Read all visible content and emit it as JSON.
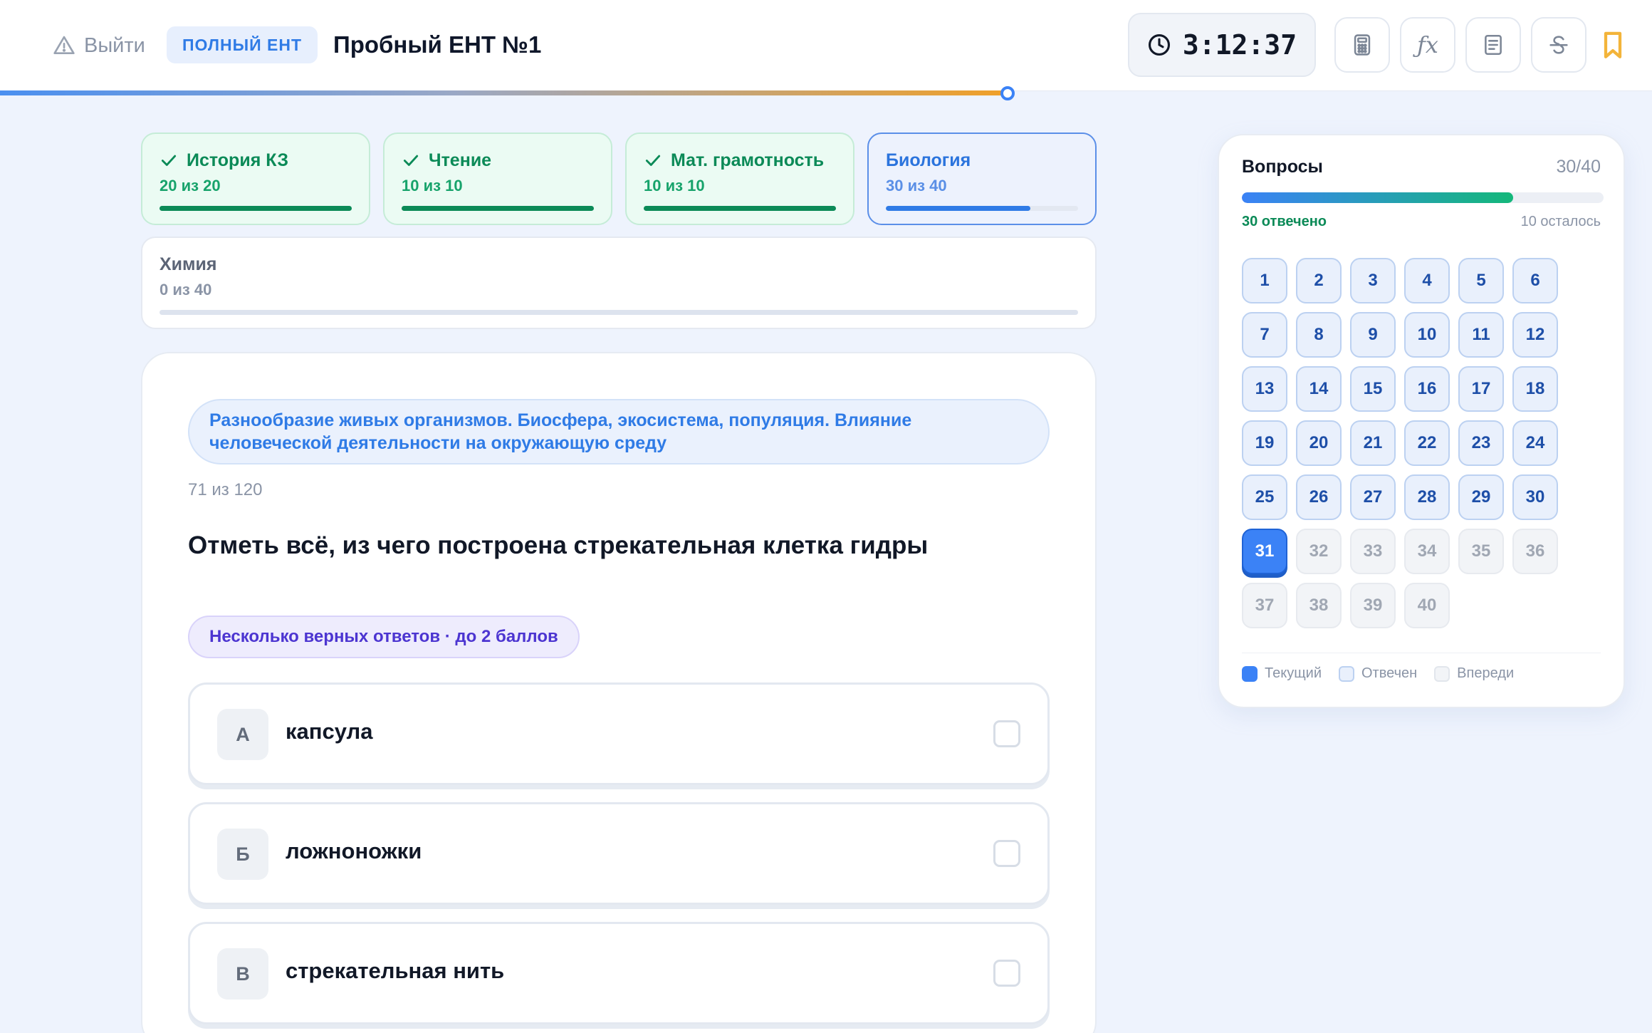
{
  "header": {
    "exit_label": "Выйти",
    "mode_badge": "ПОЛНЫЙ ЕНТ",
    "title": "Пробный ЕНТ №1",
    "timer": "3:12:37",
    "tools": [
      "calculator-icon",
      "formula-icon",
      "document-icon",
      "strikethrough-icon",
      "bookmark-icon"
    ],
    "progress": 0.61
  },
  "subjects": [
    {
      "name": "История КЗ",
      "count": "20 из 20",
      "status": "done",
      "progress": 1.0
    },
    {
      "name": "Чтение",
      "count": "10 из 10",
      "status": "done",
      "progress": 1.0
    },
    {
      "name": "Мат. грамотность",
      "count": "10 из 10",
      "status": "done",
      "progress": 1.0
    },
    {
      "name": "Биология",
      "count": "30 из 40",
      "status": "active",
      "progress": 0.75
    },
    {
      "name": "Химия",
      "count": "0 из 40",
      "status": "todo",
      "progress": 0
    }
  ],
  "question": {
    "topic": "Разнообразие живых организмов. Биосфера, экосистема, популяция. Влияние человеческой деятельности на окружающую среду",
    "number": "71 из 120",
    "text": "Отметь всё, из чего построена стрекательная клетка гидры",
    "type": "Несколько верных ответов · до 2 баллов",
    "options": [
      {
        "letter": "А",
        "text": "капсула",
        "checked": false
      },
      {
        "letter": "Б",
        "text": "ложноножки",
        "checked": false
      },
      {
        "letter": "В",
        "text": "стрекательная нить",
        "checked": false
      }
    ]
  },
  "navigator": {
    "title": "Вопросы",
    "count": "30/40",
    "answered_label": "30 отвечено",
    "left_label": "10 осталось",
    "progress": 0.75,
    "total": 40,
    "answered": 30,
    "current": 31,
    "legend": [
      "Текущий",
      "Отвечен",
      "Впереди"
    ]
  },
  "colors": {
    "accent": "#3b82f6",
    "success": "#0b8a57",
    "timer_bar_end": "#f0a028",
    "multi_badge": "#4c35d1"
  }
}
